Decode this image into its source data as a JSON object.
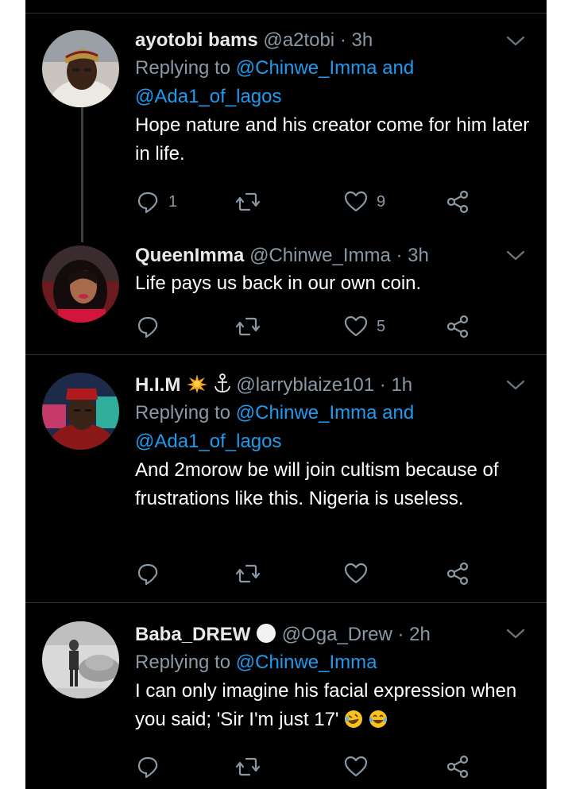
{
  "tweets": [
    {
      "name": "ayotobi bams",
      "handle": "@a2tobi",
      "time": "· 3h",
      "replying_prefix": "Replying to",
      "mention1": "@Chinwe_Imma",
      "and": "and",
      "mention2": "@Ada1_of_lagos",
      "text": "Hope nature and his creator come for him later in life.",
      "reply_count": "1",
      "like_count": "9"
    },
    {
      "name": "QueenImma",
      "handle": "@Chinwe_Imma",
      "time": "· 3h",
      "text": "Life pays us back in our own coin.",
      "reply_count": "",
      "like_count": "5"
    },
    {
      "name": "H.I.M",
      "name_icons": [
        "sparkle-sun-icon",
        "anchor-icon"
      ],
      "handle": "@larryblaize101",
      "time": "· 1h",
      "replying_prefix": "Replying to",
      "mention1": "@Chinwe_Imma",
      "and": "and",
      "mention2": "@Ada1_of_lagos",
      "text": "And 2morow be will join cultism because of frustrations like this. Nigeria is useless.",
      "reply_count": "",
      "like_count": ""
    },
    {
      "name": "Baba_DREW",
      "name_icons": [
        "white-circle-icon"
      ],
      "handle": "@Oga_Drew",
      "time": "· 2h",
      "replying_prefix": "Replying to",
      "mention1": "@Chinwe_Imma",
      "text": "I can only imagine his facial expression when you said; 'Sir I'm just 17'",
      "text_emoji": [
        "rolling-laugh-emoji",
        "tears-of-joy-emoji"
      ],
      "reply_count": "",
      "like_count": ""
    }
  ],
  "colors": {
    "background": "#000000",
    "primary_text": "#ffffff",
    "secondary_text": "#8b98a5",
    "link": "#1d9bf0",
    "divider": "#2f3336"
  },
  "icons": [
    "reply-icon",
    "retweet-icon",
    "like-icon",
    "share-icon",
    "chevron-down-icon"
  ]
}
